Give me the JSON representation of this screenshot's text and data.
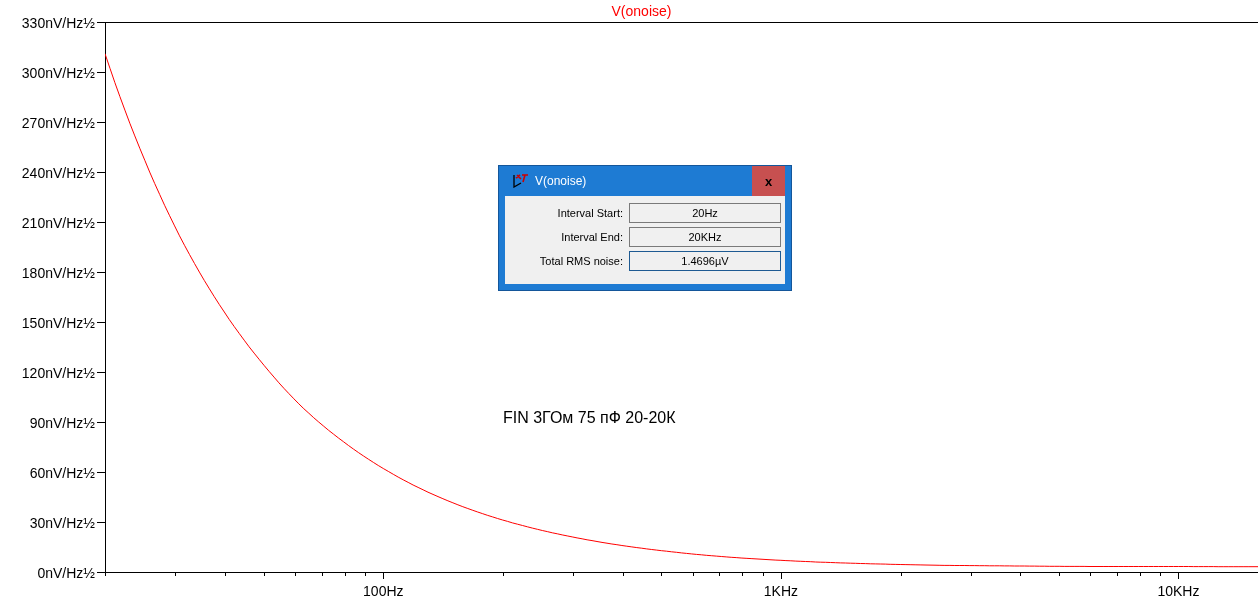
{
  "chart_data": {
    "type": "line",
    "categories": [
      null,
      null,
      null,
      null,
      null,
      null,
      null,
      "100Hz",
      null,
      null,
      null,
      null,
      null,
      null,
      null,
      null,
      null,
      "1KHz",
      null,
      null,
      null,
      null,
      null,
      null,
      null,
      null,
      null,
      "10KHz",
      null,
      null
    ],
    "series": [
      {
        "name": "V(onoise)",
        "color": "#ff0000",
        "values": [
          311,
          247,
          196,
          156,
          124,
          98,
          78.1,
          62.1,
          49.3,
          39.2,
          31.2,
          24.9,
          19.9,
          15.9,
          12.8,
          10.3,
          8.4,
          7.0,
          5.9,
          5.1,
          4.5,
          4.0,
          3.8,
          3.6,
          3.4,
          3.3,
          3.3,
          3.3,
          3.2,
          3.2
        ]
      }
    ],
    "ylim": [
      0,
      330
    ],
    "yticks": [
      {
        "value": 0,
        "label": "0nV/Hz½"
      },
      {
        "value": 30,
        "label": "30nV/Hz½"
      },
      {
        "value": 60,
        "label": "60nV/Hz½"
      },
      {
        "value": 90,
        "label": "90nV/Hz½"
      },
      {
        "value": 120,
        "label": "120nV/Hz½"
      },
      {
        "value": 150,
        "label": "150nV/Hz½"
      },
      {
        "value": 180,
        "label": "180nV/Hz½"
      },
      {
        "value": 210,
        "label": "210nV/Hz½"
      },
      {
        "value": 240,
        "label": "240nV/Hz½"
      },
      {
        "value": 270,
        "label": "270nV/Hz½"
      },
      {
        "value": 300,
        "label": "300nV/Hz½"
      },
      {
        "value": 330,
        "label": "330nV/Hz½"
      }
    ],
    "annotations": [
      "FIN 3ГОм 75 пФ 20-20К"
    ]
  },
  "dialog": {
    "title": "V(onoise)",
    "close_label": "x",
    "fields": [
      {
        "label": "Interval Start:",
        "value": "20Hz",
        "focused": false
      },
      {
        "label": "Interval End:",
        "value": "20KHz",
        "focused": false
      },
      {
        "label": "Total RMS noise:",
        "value": "1.4696µV",
        "focused": true
      }
    ]
  }
}
